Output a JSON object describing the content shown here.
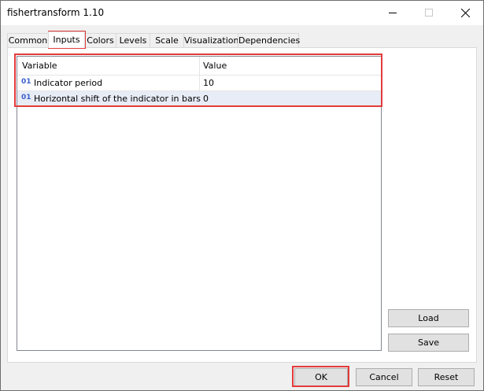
{
  "window": {
    "title": "fishertransform 1.10"
  },
  "tabs": [
    {
      "label": "Common"
    },
    {
      "label": "Inputs"
    },
    {
      "label": "Colors"
    },
    {
      "label": "Levels"
    },
    {
      "label": "Scale"
    },
    {
      "label": "Visualization"
    },
    {
      "label": "Dependencies"
    }
  ],
  "inputs": {
    "columns": {
      "variable": "Variable",
      "value": "Value"
    },
    "type_badge": "01",
    "rows": [
      {
        "variable": "Indicator period",
        "value": "10"
      },
      {
        "variable": "Horizontal shift of the indicator in bars",
        "value": "0"
      }
    ]
  },
  "side_buttons": {
    "load": "Load",
    "save": "Save"
  },
  "dialog_buttons": {
    "ok": "OK",
    "cancel": "Cancel",
    "reset": "Reset"
  },
  "colors": {
    "highlight": "#e33b3b",
    "selected_row": "#e7ecf6"
  }
}
